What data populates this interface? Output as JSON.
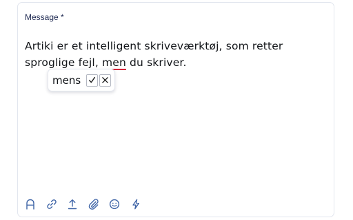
{
  "form": {
    "label": "Message *"
  },
  "message": {
    "text_before": "Artiki er et intelligent skriveværktøj, som retter sproglige fejl, ",
    "flagged_word": "men",
    "text_after": " du skriver."
  },
  "suggestion": {
    "word": "mens",
    "accept_icon": "check-icon",
    "dismiss_icon": "close-icon"
  },
  "toolbar": {
    "icons": [
      "font-icon",
      "link-icon",
      "upload-icon",
      "attachment-icon",
      "emoji-icon",
      "lightning-icon"
    ]
  },
  "colors": {
    "label": "#1f2a52",
    "toolbar_icon": "#3d63a6",
    "error_underline": "#d6243a",
    "card_border": "#e2e6ee"
  }
}
